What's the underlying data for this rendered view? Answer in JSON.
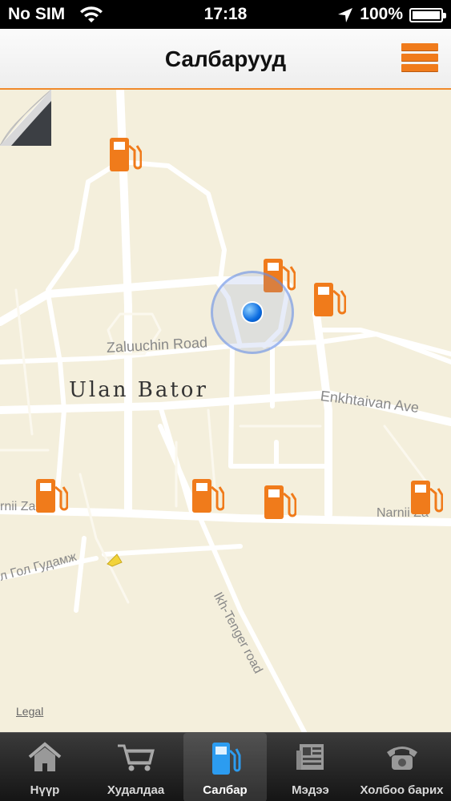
{
  "status": {
    "carrier": "No SIM",
    "time": "17:18",
    "battery": "100%"
  },
  "header": {
    "title": "Салбарууд"
  },
  "map": {
    "city_label": "Ulan Bator",
    "roads": {
      "zaluuchin": "Zaluuchin Road",
      "enkhtaivan": "Enkhtaivan Ave",
      "narnii_left": "rnii Zam",
      "narnii_right": "Narnii Za",
      "gol": "л Гол Гудамж",
      "ikh_tenger": "Ikh-Tenger road"
    },
    "legal": "Legal",
    "pins_count": 7,
    "pin_icon": "fuel-pump-icon",
    "accent": "#f07b1b"
  },
  "tabs": [
    {
      "label": "Нүүр",
      "icon": "home-icon"
    },
    {
      "label": "Худалдаа",
      "icon": "cart-icon"
    },
    {
      "label": "Салбар",
      "icon": "fuel-pump-icon",
      "active": true
    },
    {
      "label": "Мэдээ",
      "icon": "newspaper-icon"
    },
    {
      "label": "Холбоо барих",
      "icon": "phone-icon"
    }
  ]
}
